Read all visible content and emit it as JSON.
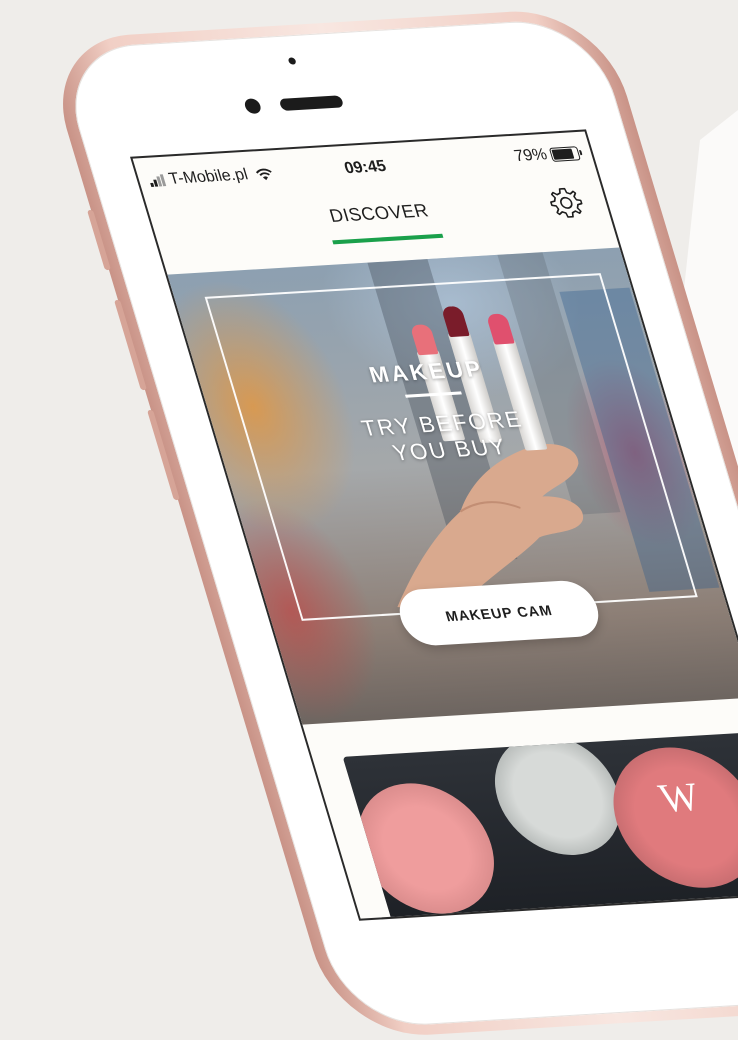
{
  "status_bar": {
    "carrier": "T-Mobile.pl",
    "time": "09:45",
    "battery": "79%",
    "signal_icon": "signal-bars-icon",
    "wifi_icon": "wifi-icon",
    "battery_icon": "battery-icon"
  },
  "header": {
    "title": "DISCOVER",
    "settings_icon": "gear-icon",
    "accent_color": "#1aa04b"
  },
  "hero": {
    "label": "MAKEUP",
    "tagline_line1": "TRY BEFORE",
    "tagline_line2": "YOU BUY",
    "button_label": "MAKEUP CAM"
  },
  "card_two": {
    "initial": "W"
  }
}
